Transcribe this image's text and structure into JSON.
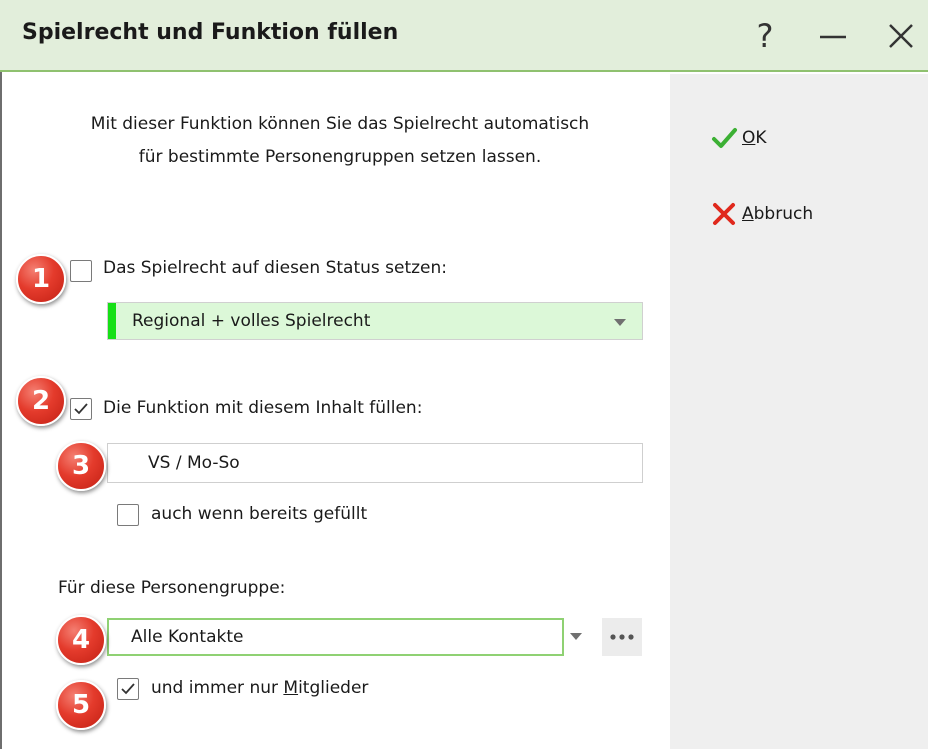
{
  "window": {
    "title": "Spielrecht und Funktion füllen",
    "help_glyph": "?",
    "title_bar_color": "#e2eedb",
    "title_bar_border_color": "#8fc16f"
  },
  "description": "Mit dieser Funktion können Sie das Spielrecht automatisch für bestimmte Personengruppen setzen lassen.",
  "status_section": {
    "checkbox_label": "Das Spielrecht auf diesen Status setzen:",
    "checked": false,
    "selected_value": "Regional + volles Spielrecht",
    "status_color": "#16e016"
  },
  "function_section": {
    "checkbox_label": "Die Funktion mit diesem Inhalt füllen:",
    "checked": true,
    "input_value": "VS / Mo-So",
    "also_if_filled_label": "auch wenn bereits gefüllt",
    "also_if_filled_checked": false
  },
  "group_section": {
    "label": "Für diese Personengruppe:",
    "selected_value": "Alle Kontakte",
    "members_only_prefix": "und immer nur ",
    "members_only_mnemonic": "M",
    "members_only_rest": "itglieder",
    "members_only_checked": true
  },
  "actions": {
    "ok_mnemonic": "O",
    "ok_rest": "K",
    "cancel_mnemonic": "A",
    "cancel_rest": "bbruch"
  },
  "badges": [
    "1",
    "2",
    "3",
    "4",
    "5"
  ],
  "colors": {
    "ok_icon": "#3cb034",
    "cancel_icon": "#e0281c",
    "badge": "#e43b2c",
    "side_panel": "#efefef"
  }
}
